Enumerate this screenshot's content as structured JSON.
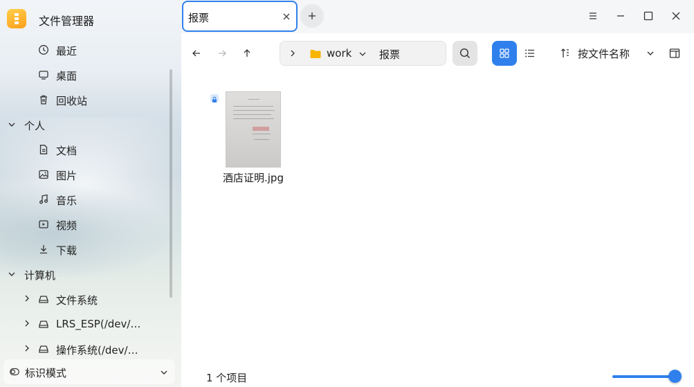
{
  "app": {
    "title": "文件管理器"
  },
  "sidebar": {
    "quick": [
      {
        "label": "最近",
        "icon": "clock-icon"
      },
      {
        "label": "桌面",
        "icon": "desktop-icon"
      },
      {
        "label": "回收站",
        "icon": "trash-icon"
      }
    ],
    "groups": [
      {
        "label": "个人",
        "expanded": true,
        "items": [
          {
            "label": "文档",
            "icon": "document-icon"
          },
          {
            "label": "图片",
            "icon": "image-icon"
          },
          {
            "label": "音乐",
            "icon": "music-icon"
          },
          {
            "label": "视频",
            "icon": "video-icon"
          },
          {
            "label": "下载",
            "icon": "download-icon"
          }
        ]
      },
      {
        "label": "计算机",
        "expanded": true,
        "items": [
          {
            "label": "文件系统",
            "icon": "drive-icon"
          },
          {
            "label": "LRS_ESP(/dev/…",
            "icon": "drive-icon"
          },
          {
            "label": "操作系统(/dev/…",
            "icon": "drive-icon"
          }
        ]
      }
    ],
    "mode": {
      "label": "标识模式"
    }
  },
  "tabs": [
    {
      "label": "报票",
      "active": true
    }
  ],
  "breadcrumb": {
    "segments": [
      "work",
      "报票"
    ]
  },
  "sort": {
    "label": "按文件名称"
  },
  "files": [
    {
      "name": "酒店证明.jpg",
      "type": "image",
      "locked": true
    }
  ],
  "status": {
    "item_count": "1 个项目",
    "zoom_level": 1.0
  },
  "colors": {
    "accent": "#2f80ed",
    "folder": "#f7b500"
  }
}
